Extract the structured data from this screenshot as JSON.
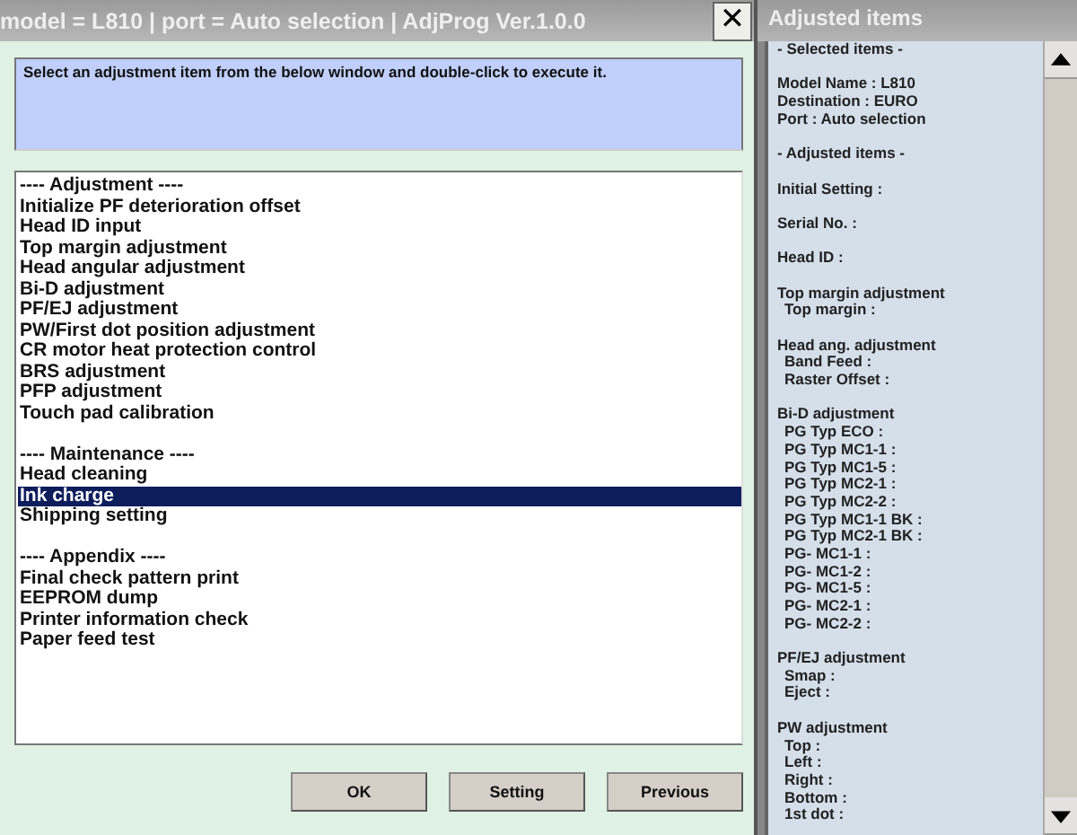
{
  "window": {
    "title": "model = L810 | port = Auto selection | AdjProg Ver.1.0.0",
    "close": "✕"
  },
  "message": "Select an adjustment item from the below window and double-click to execute it.",
  "sections": [
    {
      "heading": "---- Adjustment ----",
      "items": [
        {
          "label": "Initialize PF deterioration offset",
          "selected": false
        },
        {
          "label": "Head ID input",
          "selected": false
        },
        {
          "label": "Top margin adjustment",
          "selected": false
        },
        {
          "label": "Head angular adjustment",
          "selected": false
        },
        {
          "label": "Bi-D adjustment",
          "selected": false
        },
        {
          "label": "PF/EJ adjustment",
          "selected": false
        },
        {
          "label": "PW/First dot position adjustment",
          "selected": false
        },
        {
          "label": "CR motor heat protection control",
          "selected": false
        },
        {
          "label": "BRS adjustment",
          "selected": false
        },
        {
          "label": "PFP adjustment",
          "selected": false
        },
        {
          "label": "Touch pad calibration",
          "selected": false
        }
      ]
    },
    {
      "heading": "---- Maintenance ----",
      "items": [
        {
          "label": "Head cleaning",
          "selected": false
        },
        {
          "label": "Ink charge",
          "selected": true
        },
        {
          "label": "Shipping setting",
          "selected": false
        }
      ]
    },
    {
      "heading": "---- Appendix ----",
      "items": [
        {
          "label": "Final check pattern print",
          "selected": false
        },
        {
          "label": "EEPROM dump",
          "selected": false
        },
        {
          "label": "Printer information check",
          "selected": false
        },
        {
          "label": "Paper feed test",
          "selected": false
        }
      ]
    }
  ],
  "buttons": [
    "OK",
    "Setting",
    "Previous"
  ],
  "side_panel": {
    "title": "Adjusted items",
    "blocks": [
      {
        "lines": [
          "- Selected items -"
        ]
      },
      {
        "lines": [
          "Model Name : L810",
          "Destination : EURO",
          "Port : Auto selection"
        ]
      },
      {
        "lines": [
          "- Adjusted items -"
        ]
      },
      {
        "lines": [
          "Initial Setting :"
        ]
      },
      {
        "lines": [
          "Serial No. :"
        ]
      },
      {
        "lines": [
          "Head ID :"
        ]
      },
      {
        "lines": [
          "Top margin adjustment"
        ],
        "children": [
          "Top margin :"
        ]
      },
      {
        "lines": [
          "Head ang. adjustment"
        ],
        "children": [
          "Band Feed :",
          "Raster Offset :"
        ]
      },
      {
        "lines": [
          "Bi-D adjustment"
        ],
        "children": [
          "PG Typ ECO :",
          "PG Typ MC1-1 :",
          "PG Typ MC1-5 :",
          "PG Typ MC2-1 :",
          "PG Typ MC2-2 :",
          "PG Typ MC1-1 BK :",
          "PG Typ MC2-1 BK :",
          "PG- MC1-1 :",
          "PG- MC1-2 :",
          "PG- MC1-5 :",
          "PG- MC2-1 :",
          "PG- MC2-2 :"
        ]
      },
      {
        "lines": [
          "PF/EJ adjustment"
        ],
        "children": [
          "Smap :",
          "Eject :"
        ]
      },
      {
        "lines": [
          "PW adjustment"
        ],
        "children": [
          "Top :",
          "Left :",
          "Right :",
          "Bottom :",
          "1st dot :"
        ]
      }
    ]
  }
}
